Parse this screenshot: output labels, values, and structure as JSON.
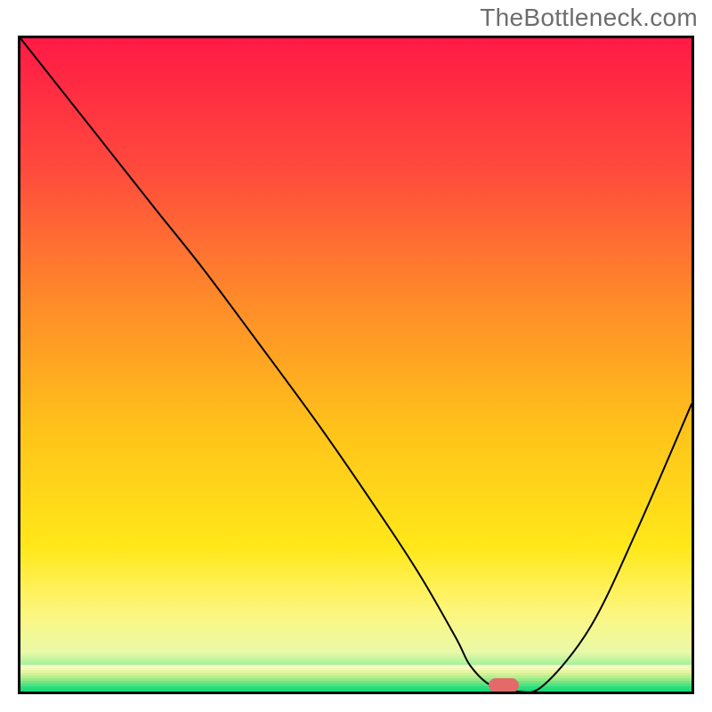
{
  "watermark": "TheBottleneck.com",
  "chart_data": {
    "type": "line",
    "title": "",
    "xlabel": "",
    "ylabel": "",
    "xlim": [
      0,
      100
    ],
    "ylim": [
      0,
      100
    ],
    "series": [
      {
        "name": "bottleneck-curve",
        "x": [
          0,
          10,
          20,
          27,
          35,
          45,
          55,
          60,
          65,
          67,
          70,
          74,
          78,
          85,
          92,
          100
        ],
        "values": [
          100,
          87,
          74,
          65,
          54,
          40,
          25,
          17,
          8,
          4,
          1,
          0,
          1,
          10,
          25,
          44
        ]
      }
    ],
    "marker": {
      "x": 72,
      "y": 1,
      "color": "#e46a6a"
    },
    "gradient_stops": [
      {
        "offset": 0.0,
        "color": "#ff1a45"
      },
      {
        "offset": 0.2,
        "color": "#ff4a3d"
      },
      {
        "offset": 0.4,
        "color": "#ff8a2a"
      },
      {
        "offset": 0.6,
        "color": "#ffc31a"
      },
      {
        "offset": 0.78,
        "color": "#ffe81a"
      },
      {
        "offset": 0.88,
        "color": "#fdf67f"
      },
      {
        "offset": 0.94,
        "color": "#e9f9a8"
      },
      {
        "offset": 1.0,
        "color": "#0fe07a"
      }
    ],
    "bottom_bands": [
      "#f9fbc8",
      "#f1f9b4",
      "#e5f6a2",
      "#d2f295",
      "#b7ee8e",
      "#97ea88",
      "#73e583",
      "#4fe180",
      "#2cdd7d",
      "#0fe07a"
    ]
  }
}
